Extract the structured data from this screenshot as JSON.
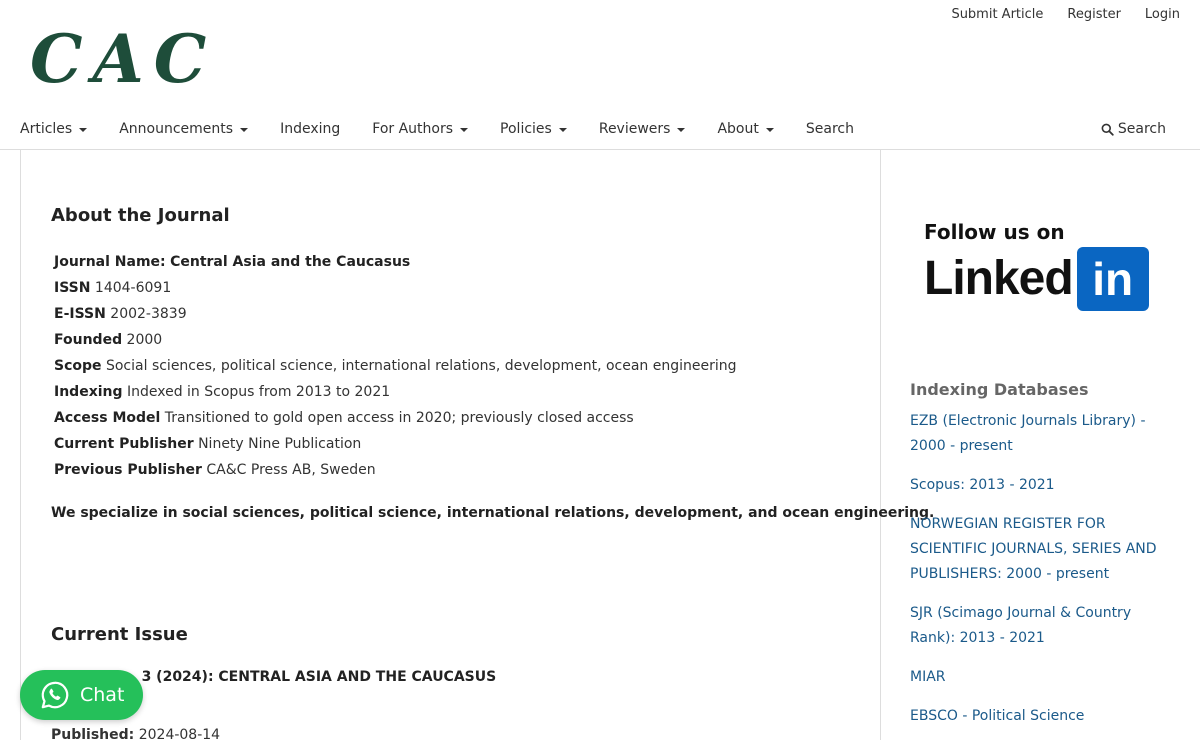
{
  "user_nav": {
    "submit": "Submit Article",
    "register": "Register",
    "login": "Login"
  },
  "logo": {
    "text": "CAC",
    "color": "#1e4d3a"
  },
  "primary_nav": [
    {
      "label": "Articles",
      "dropdown": true
    },
    {
      "label": "Announcements",
      "dropdown": true
    },
    {
      "label": "Indexing",
      "dropdown": false
    },
    {
      "label": "For Authors",
      "dropdown": true
    },
    {
      "label": "Policies",
      "dropdown": true
    },
    {
      "label": "Reviewers",
      "dropdown": true
    },
    {
      "label": "About",
      "dropdown": true
    },
    {
      "label": "Search",
      "dropdown": false
    }
  ],
  "search": {
    "label": "Search",
    "icon": "search-icon"
  },
  "about": {
    "title": "About the Journal",
    "rows": [
      {
        "key": "Journal Name:",
        "value": "Central Asia and the Caucasus",
        "bold_value": true
      },
      {
        "key": "ISSN",
        "value": "1404-6091"
      },
      {
        "key": "E-ISSN",
        "value": "2002-3839"
      },
      {
        "key": "Founded",
        "value": "2000"
      },
      {
        "key": "Scope",
        "value": "Social sciences, political science, international relations, development, ocean engineering"
      },
      {
        "key": "Indexing",
        "value": "Indexed in Scopus from 2013 to 2021"
      },
      {
        "key": "Access Model",
        "value": "Transitioned to gold open access in 2020; previously closed access"
      },
      {
        "key": "Current Publisher",
        "value": "Ninety Nine Publication"
      },
      {
        "key": "Previous Publisher",
        "value": "CA&C Press AB, Sweden"
      }
    ],
    "tagline": "We specialize in social sciences, political science, international relations, development, and ocean engineering."
  },
  "current_issue": {
    "title": "Current Issue",
    "issue_title": "Vol. 27 No. 3 (2024): CENTRAL ASIA AND THE CAUCASUS",
    "published_label": "Published:",
    "published_date": "2024-08-14"
  },
  "chat": {
    "label": "Chat",
    "color": "#25c05a"
  },
  "sidebar": {
    "follow_text": "Follow us on",
    "linkedin_word": "Linked",
    "linkedin_box": "in",
    "linkedin_color": "#0a66c2",
    "indexing_title": "Indexing Databases",
    "databases": [
      "EZB (Electronic Journals Library) - 2000 - present",
      "Scopus: 2013 - 2021",
      "NORWEGIAN REGISTER FOR SCIENTIFIC JOURNALS, SERIES AND PUBLISHERS: 2000 - present",
      "SJR (Scimago Journal & Country Rank): 2013 - 2021",
      "MIAR",
      "EBSCO - Political Science"
    ]
  }
}
